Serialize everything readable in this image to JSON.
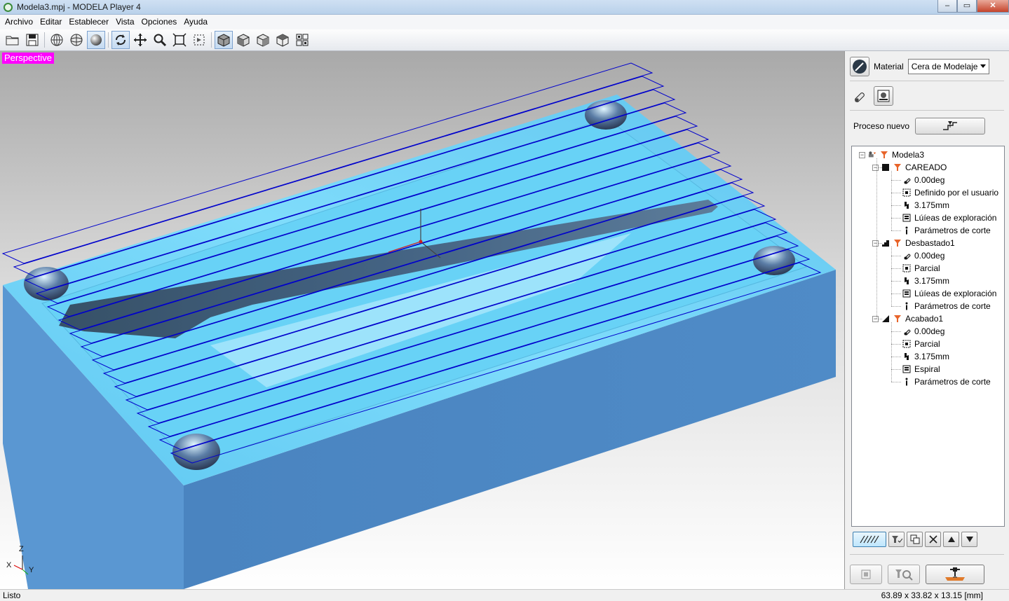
{
  "window": {
    "title": "Modela3.mpj - MODELA Player 4",
    "min_symbol": "‒",
    "max_symbol": "▭",
    "close_symbol": "✕"
  },
  "menu": [
    "Archivo",
    "Editar",
    "Establecer",
    "Vista",
    "Opciones",
    "Ayuda"
  ],
  "toolbar": {
    "icons": [
      "open-folder-icon",
      "save-icon",
      "wireframe-icon",
      "surface-wire-icon",
      "render-sphere-icon",
      "rotate-icon",
      "pan-icon",
      "zoom-icon",
      "zoom-fit-icon",
      "zoom-region-icon",
      "view-iso-icon",
      "view-front-icon",
      "view-top-icon",
      "view-side-icon",
      "multi-view-icon"
    ]
  },
  "viewport": {
    "label": "Perspective",
    "axis": {
      "z": "Z",
      "x": "X",
      "y": "Y"
    },
    "colors": {
      "model_top": "#6fd0f4",
      "model_side": "#4a86c2",
      "toolpath": "#0000cc"
    }
  },
  "side_panel": {
    "material_label": "Material",
    "material_value": "Cera de Modelaje",
    "new_process_label": "Proceso nuevo"
  },
  "tree": {
    "root": "Modela3",
    "processes": [
      {
        "name": "CAREADO",
        "children": [
          "0.00deg",
          "Definido por el usuario",
          "3.175mm",
          "Lúíeas de exploración",
          "Parámetros de corte"
        ]
      },
      {
        "name": "Desbastado1",
        "children": [
          "0.00deg",
          "Parcial",
          "3.175mm",
          "Lúíeas de exploración",
          "Parámetros de corte"
        ]
      },
      {
        "name": "Acabado1",
        "children": [
          "0.00deg",
          "Parcial",
          "3.175mm",
          "Espiral",
          "Parámetros de corte"
        ]
      }
    ]
  },
  "status": {
    "left": "Listo",
    "right": "63.89 x 33.82 x 13.15 [mm]"
  }
}
